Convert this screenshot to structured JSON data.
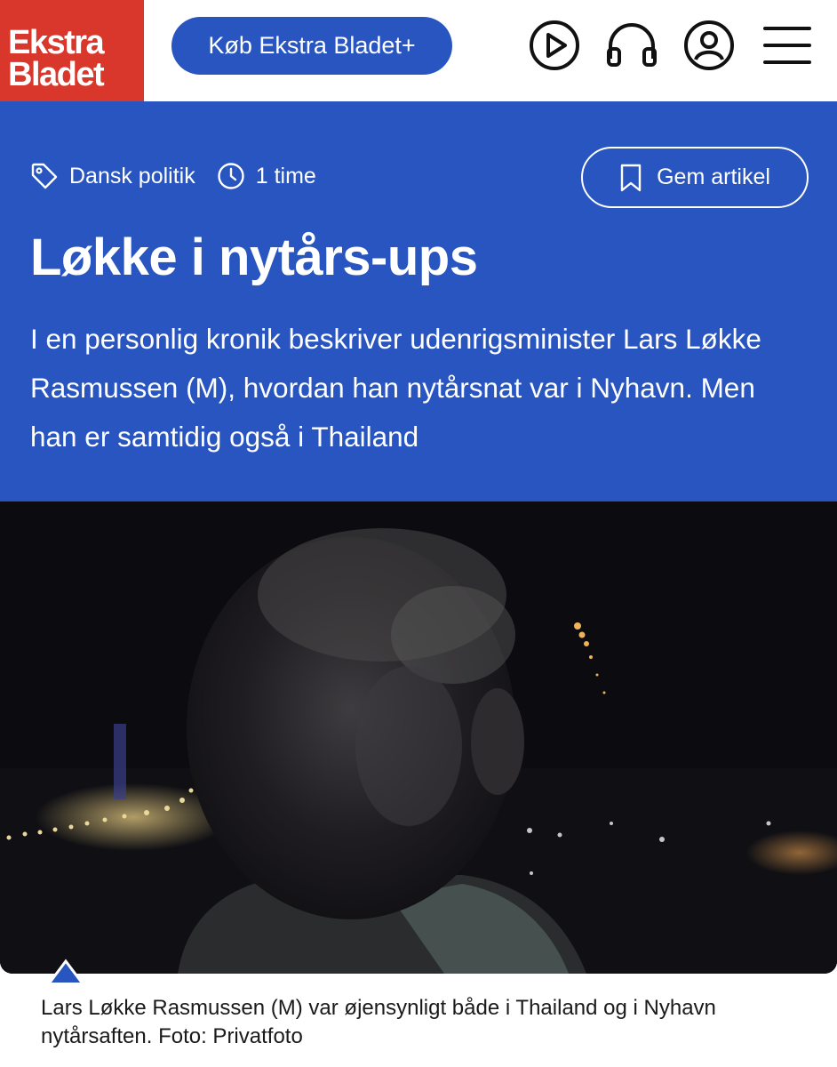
{
  "header": {
    "logo_line1": "Ekstra",
    "logo_line2": "Bladet",
    "buy_label": "Køb Ekstra Bladet+",
    "icons": [
      "play-icon",
      "headphones-icon",
      "user-icon",
      "menu-icon"
    ],
    "logo_color": "#d9372b"
  },
  "article": {
    "category": "Dansk politik",
    "time": "1 time",
    "save_label": "Gem artikel",
    "headline": "Løkke i nytårs-ups",
    "lead": "I en personlig kronik beskriver udenrigsminister Lars Løkke Rasmussen (M), hvordan han nytårsnat var i Nyhavn. Men han er samtidig også i Thailand",
    "accent_color": "#2855c0"
  },
  "image": {
    "caption": "Lars Løkke Rasmussen (M) var øjensynligt både i Thailand og i Nyhavn nytårsaften. Foto: Privatfoto"
  }
}
